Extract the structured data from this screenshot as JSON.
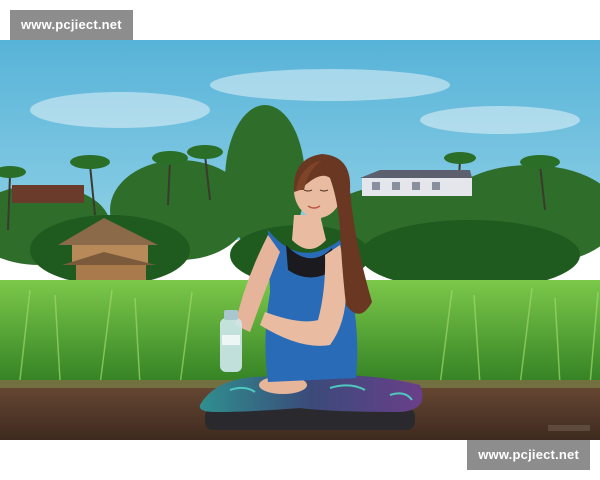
{
  "watermark": {
    "top_left_text": "www.pcjiect.net",
    "bottom_right_text": "www.pcjiect.net"
  },
  "colors": {
    "sky": "#6fc3e0",
    "grass": "#3f9a2d",
    "tank_top": "#2a6bb8",
    "leggings": "#3b4a7a",
    "ground": "#5a3a2a",
    "watermark_bg": "#8d8d8d"
  }
}
